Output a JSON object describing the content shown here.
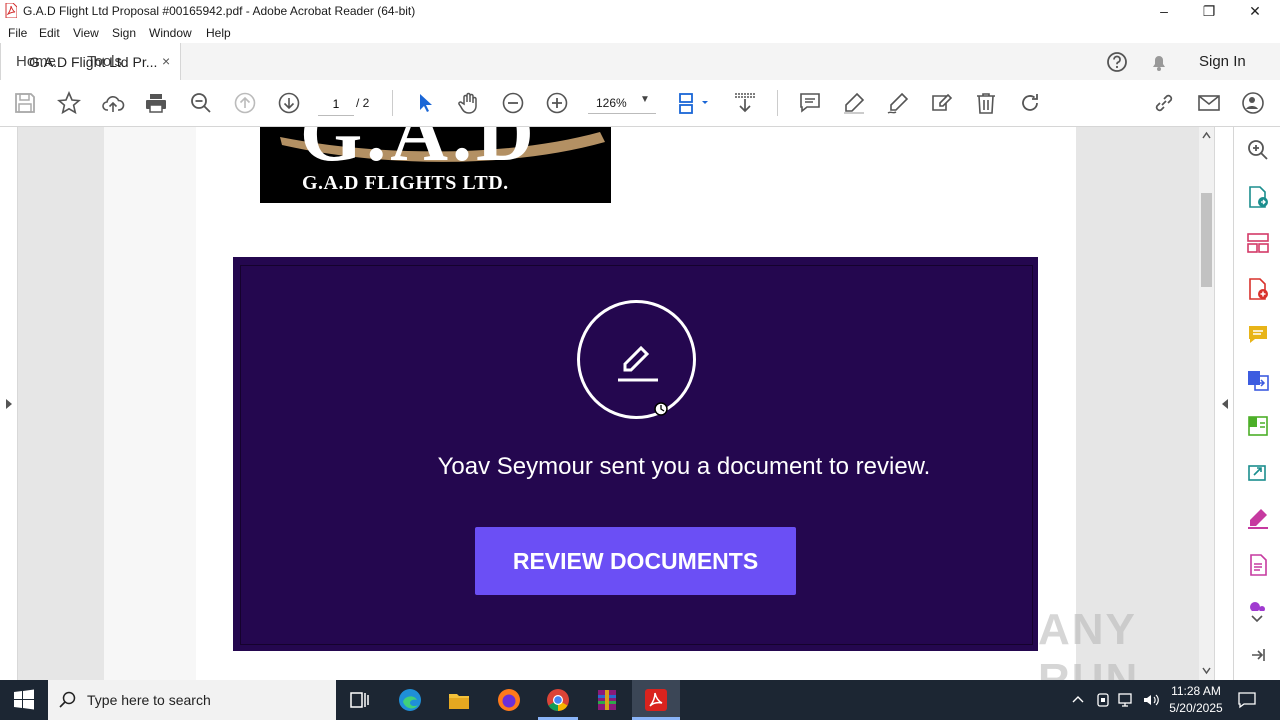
{
  "window": {
    "title": "G.A.D Flight Ltd Proposal #00165942.pdf - Adobe Acrobat Reader (64-bit)",
    "controls": [
      "minimize",
      "restore",
      "close"
    ]
  },
  "menu": [
    "File",
    "Edit",
    "View",
    "Sign",
    "Window",
    "Help"
  ],
  "tabs": {
    "home": "Home",
    "tools": "Tools",
    "document": "G.A.D Flight Ltd Pr...",
    "close": "×",
    "signin": "Sign In"
  },
  "toolbar": {
    "page_current": "1",
    "page_total": "/ 2",
    "zoom": "126%",
    "icons": [
      "save-icon",
      "bookmark-star-icon",
      "upload-cloud-icon",
      "print-icon",
      "zoom-out-magnifier-icon",
      "page-up-icon",
      "page-down-icon",
      "select-arrow-icon",
      "hand-icon",
      "zoom-minus-icon",
      "zoom-plus-icon",
      "fit-page-icon",
      "scroll-mode-icon",
      "comment-icon",
      "highlight-icon",
      "draw-icon",
      "edit-sign-icon",
      "delete-icon",
      "rotate-icon",
      "share-link-icon",
      "email-icon",
      "add-user-icon"
    ]
  },
  "document": {
    "logo_letters": "G.A.D",
    "logo_text": "G.A.D FLIGHTS LTD.",
    "message": "Yoav Seymour sent you a document to review.",
    "button": "REVIEW DOCUMENTS",
    "colors": {
      "panel": "#24074f",
      "button": "#6b4ff5"
    }
  },
  "right_tools": [
    "search-zoom-icon",
    "export-pdf-icon",
    "organize-pages-icon",
    "create-pdf-icon",
    "comment-tool-icon",
    "combine-files-icon",
    "compress-icon",
    "scan-icon",
    "fill-sign-icon",
    "more-tools-icon",
    "stamp-icon"
  ],
  "watermark": "ANY RUN",
  "taskbar": {
    "search_placeholder": "Type here to search",
    "time": "11:28 AM",
    "date": "5/20/2025"
  }
}
